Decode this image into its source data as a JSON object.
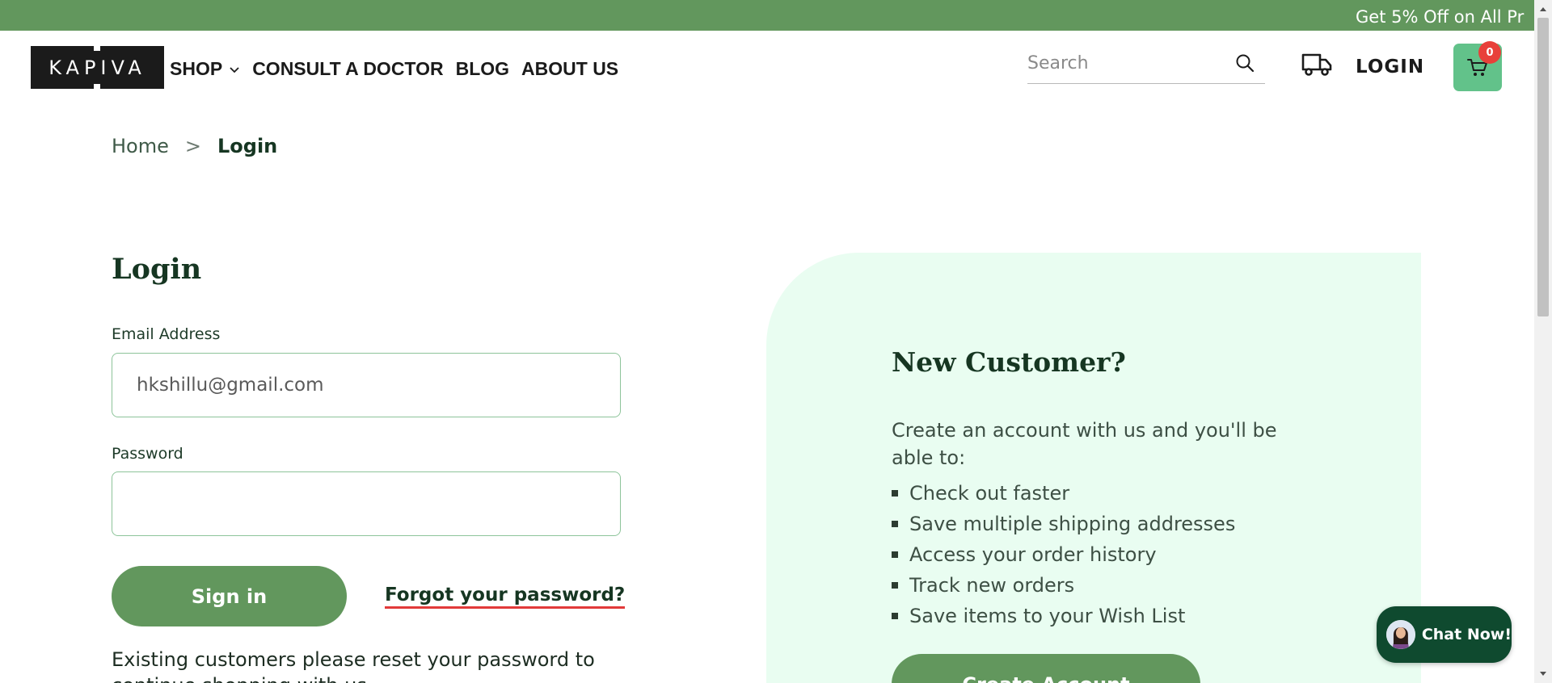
{
  "announcement": {
    "text": "Get 5% Off on All Pr"
  },
  "header": {
    "logo_text": "KAPIVA",
    "nav": [
      {
        "label": "SHOP",
        "has_dropdown": true
      },
      {
        "label": "CONSULT A DOCTOR"
      },
      {
        "label": "BLOG"
      },
      {
        "label": "ABOUT US"
      }
    ],
    "search": {
      "placeholder": "Search",
      "value": ""
    },
    "login_label": "LOGIN",
    "cart_count": "0"
  },
  "breadcrumb": {
    "home": "Home",
    "separator": ">",
    "current": "Login"
  },
  "login_form": {
    "title": "Login",
    "email_label": "Email Address",
    "email_value": "hkshillu@gmail.com",
    "password_label": "Password",
    "password_value": "",
    "signin_label": "Sign in",
    "forgot_label": "Forgot your password?",
    "existing_text": "Existing customers please reset your password to continue shopping with us"
  },
  "new_customer": {
    "title": "New Customer?",
    "intro": "Create an account with us and you'll be able to:",
    "benefits": [
      "Check out faster",
      "Save multiple shipping addresses",
      "Access your order history",
      "Track new orders",
      "Save items to your Wish List"
    ],
    "create_label": "Create Account"
  },
  "chat": {
    "label": "Chat Now!"
  },
  "colors": {
    "brand_green": "#62975d",
    "dark_green": "#163622",
    "panel_bg": "#e9fdf1",
    "cart_green": "#62c28a",
    "badge_red": "#e8403a",
    "chat_bg": "#0f4a2f"
  }
}
